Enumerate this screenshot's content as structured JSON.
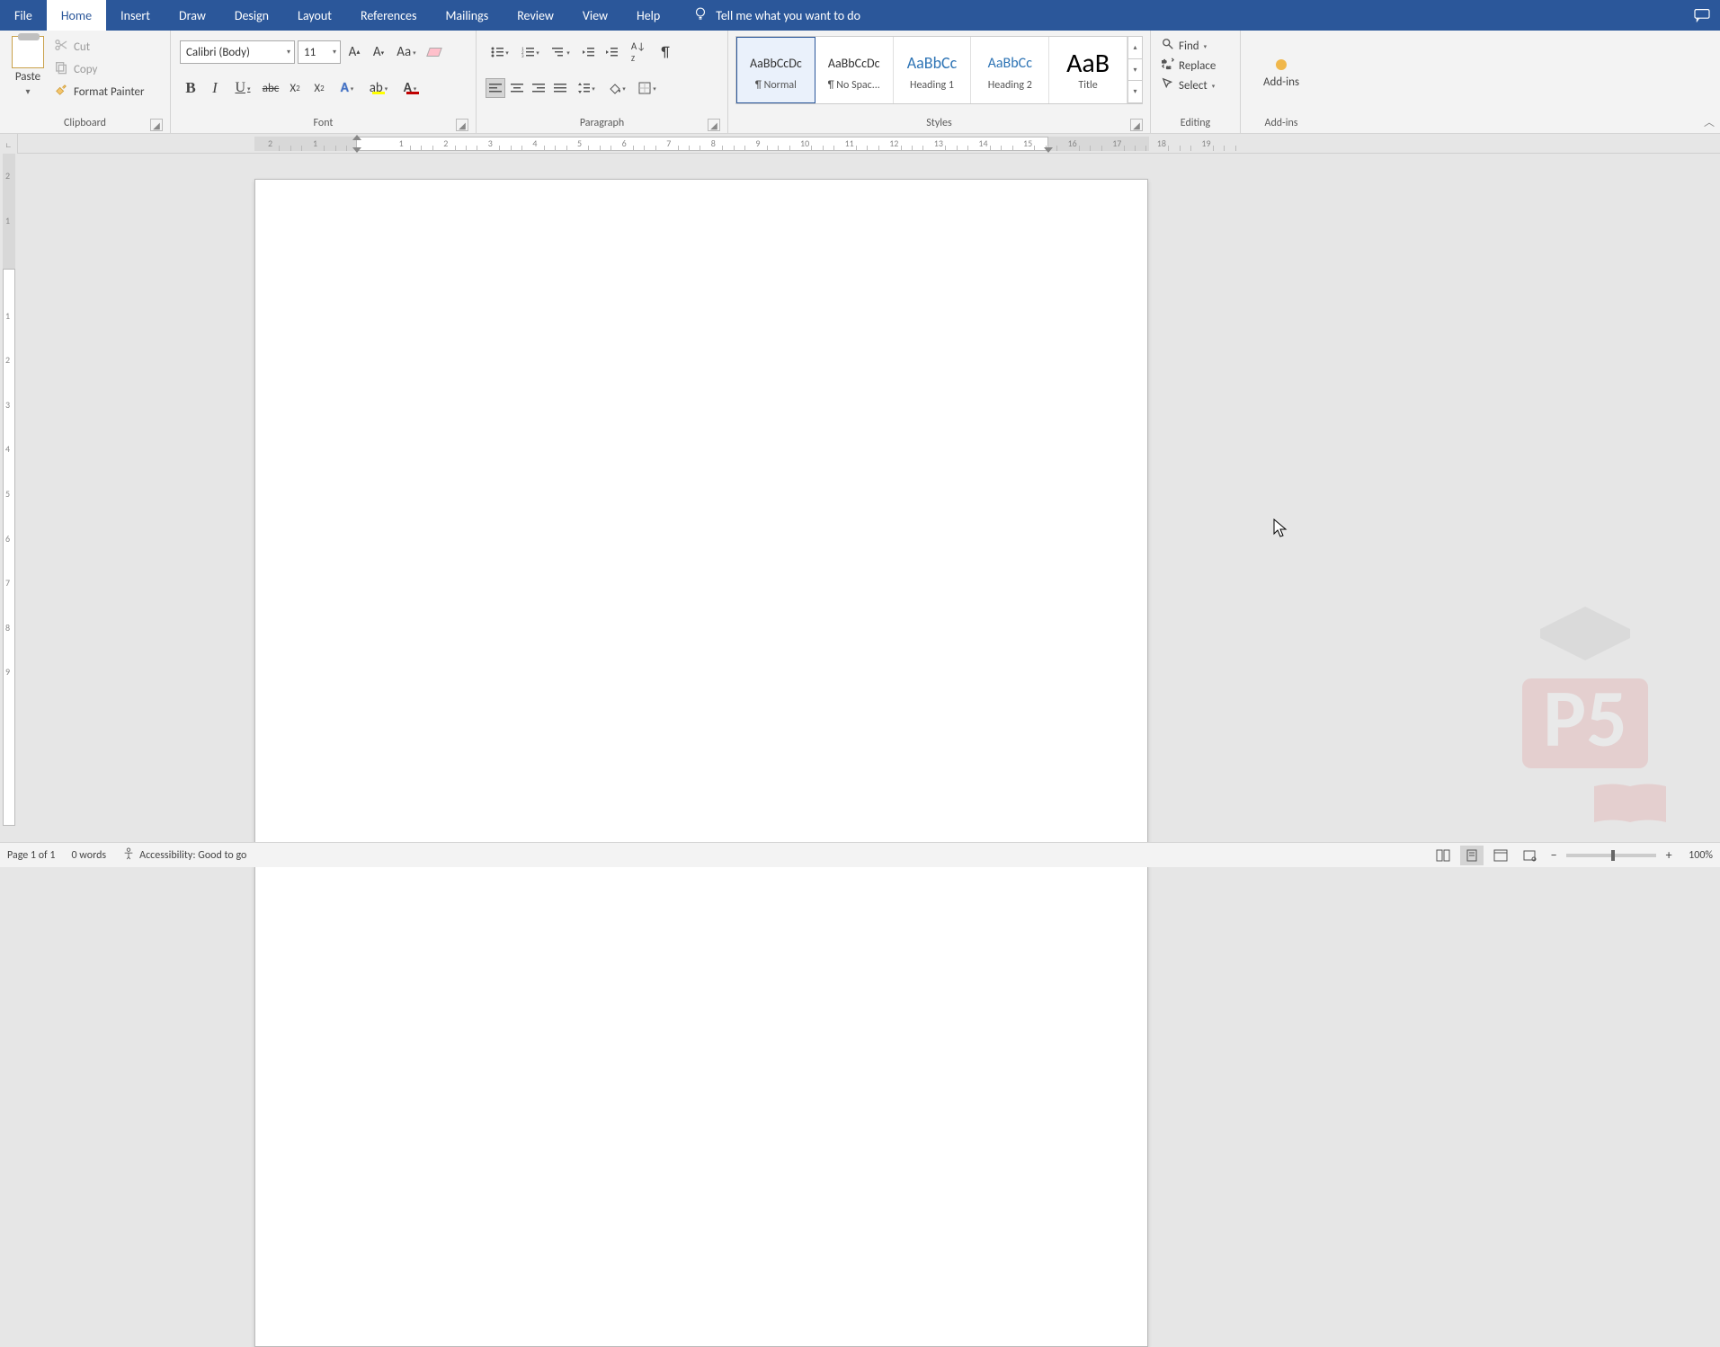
{
  "tabs": {
    "file": "File",
    "home": "Home",
    "insert": "Insert",
    "draw": "Draw",
    "design": "Design",
    "layout": "Layout",
    "references": "References",
    "mailings": "Mailings",
    "review": "Review",
    "view": "View",
    "help": "Help",
    "tell_me": "Tell me what you want to do"
  },
  "clipboard": {
    "paste": "Paste",
    "cut": "Cut",
    "copy": "Copy",
    "format_painter": "Format Painter",
    "group_label": "Clipboard"
  },
  "font": {
    "name": "Calibri (Body)",
    "size": "11",
    "group_label": "Font"
  },
  "paragraph": {
    "group_label": "Paragraph"
  },
  "styles": {
    "group_label": "Styles",
    "preview_text": "AaBbCcDc",
    "preview_heading": "AaBbCc",
    "preview_title": "AaB",
    "normal": "¶ Normal",
    "no_spacing": "¶ No Spac...",
    "heading1": "Heading 1",
    "heading2": "Heading 2",
    "title": "Title"
  },
  "editing": {
    "find": "Find",
    "replace": "Replace",
    "select": "Select",
    "group_label": "Editing"
  },
  "addins": {
    "label": "Add-ins",
    "group_label": "Add-ins"
  },
  "status": {
    "page": "Page 1 of 1",
    "words": "0 words",
    "accessibility": "Accessibility: Good to go",
    "zoom": "100%"
  },
  "ruler_h": [
    2,
    1,
    1,
    2,
    3,
    4,
    5,
    6,
    7,
    8,
    9,
    10,
    11,
    12,
    13,
    14,
    15,
    16,
    17,
    18,
    19
  ],
  "ruler_v": [
    2,
    1,
    1,
    2,
    3,
    4,
    5,
    6,
    7,
    8,
    9
  ]
}
